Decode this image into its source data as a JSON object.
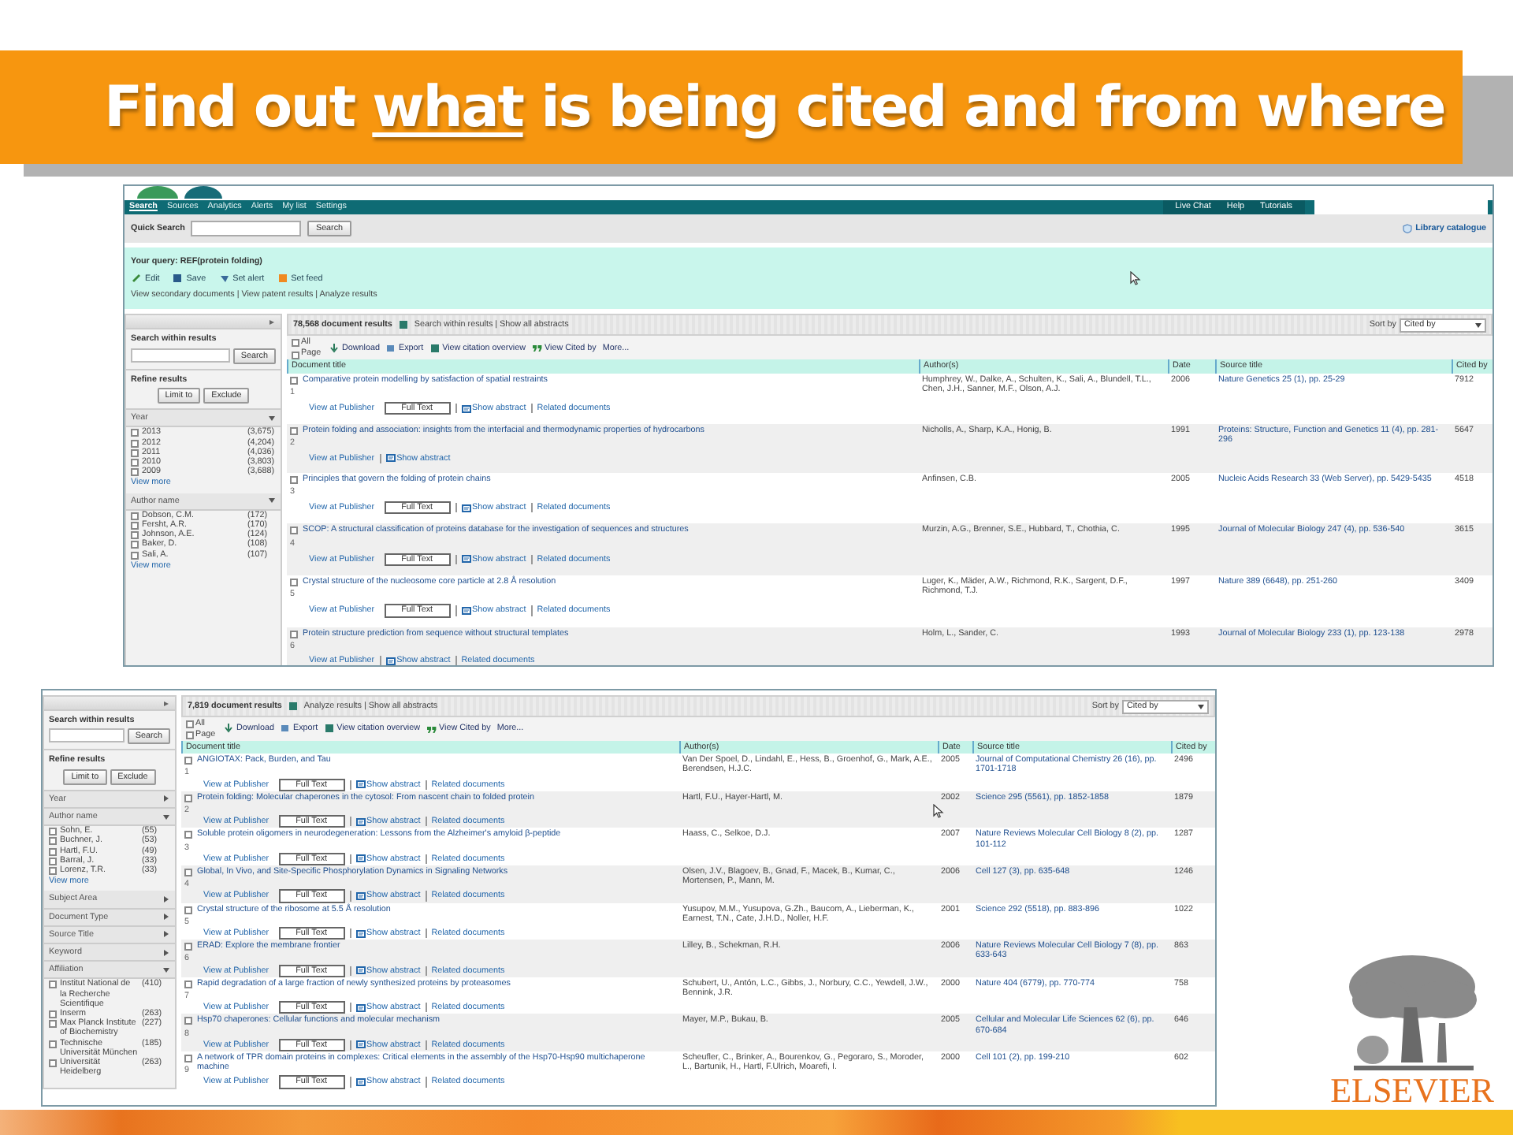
{
  "slide": {
    "title_parts": [
      {
        "text": "Find out ",
        "underlined": false
      },
      {
        "text": "what",
        "underlined": true
      },
      {
        "text": " is being cited and from where",
        "underlined": false
      }
    ]
  },
  "screenshots": [
    {
      "nav": {
        "tabs": [
          {
            "label": "Search",
            "selected": true
          },
          {
            "label": "Sources",
            "selected": false
          },
          {
            "label": "Analytics",
            "selected": false
          },
          {
            "label": "Alerts",
            "selected": false
          },
          {
            "label": "My list",
            "selected": false
          },
          {
            "label": "Settings",
            "selected": false
          }
        ],
        "links": [
          "Live Chat",
          "Help",
          "Tutorials"
        ]
      },
      "quick_search": {
        "label": "Quick Search",
        "button": "Search",
        "catalogue": "Library catalogue"
      },
      "query": {
        "text": "Your query: REF(protein folding)",
        "actions": [
          "Edit",
          "Save",
          "Set alert",
          "Set feed"
        ],
        "related": "View secondary documents | View patent results | Analyze results"
      },
      "sidebar": {
        "search_label": "Search within results",
        "search_button": "Search",
        "refine_label": "Refine results",
        "limit_button": "Limit to",
        "exclude_button": "Exclude",
        "facets": [
          {
            "title": "Year",
            "expanded": true,
            "items": [
              {
                "label": "2013",
                "count": "(3,675)",
                "checked": false
              },
              {
                "label": "2012",
                "count": "(4,204)",
                "checked": false
              },
              {
                "label": "2011",
                "count": "(4,036)",
                "checked": false
              },
              {
                "label": "2010",
                "count": "(3,803)",
                "checked": false
              },
              {
                "label": "2009",
                "count": "(3,688)",
                "checked": false
              }
            ],
            "more": "View more"
          },
          {
            "title": "Author name",
            "expanded": true,
            "items": [
              {
                "label": "Dobson, C.M.",
                "count": "(172)",
                "checked": false
              },
              {
                "label": "Fersht, A.R.",
                "count": "(170)",
                "checked": false
              },
              {
                "label": "Johnson, A.E.",
                "count": "(124)",
                "checked": false
              },
              {
                "label": "Baker, D.",
                "count": "(108)",
                "checked": false
              },
              {
                "label": "Sali, A.",
                "count": "(107)",
                "checked": false
              }
            ],
            "more": "View more"
          }
        ]
      },
      "results": {
        "count": "78,568 document results",
        "count_links": "Search within results | Show all abstracts",
        "sort_label": "Sort by",
        "sort_value": "Cited by",
        "select": [
          {
            "label": "All",
            "checked": false
          },
          {
            "label": "Page",
            "checked": false
          }
        ],
        "tools": [
          "Download",
          "Export",
          "View citation overview",
          "View Cited by",
          "More..."
        ],
        "columns": [
          "Document title",
          "Author(s)",
          "Date",
          "Source title",
          "Cited by"
        ],
        "rows": [
          {
            "number": "1",
            "title": "Comparative protein modelling by satisfaction of spatial restraints",
            "authors": "Humphrey, W., Dalke, A., Schulten, K., Sali, A., Blundell, T.L., Chen, J.H., Sanner, M.F., Olson, A.J.",
            "date": "2006",
            "source": "Nature Genetics 25 (1), pp. 25-29",
            "cited": "7912",
            "checked": false,
            "full_text": true,
            "links": [
              "View at Publisher",
              "Full Text",
              "Show abstract",
              "Related documents"
            ]
          },
          {
            "number": "2",
            "title": "Protein folding and association: insights from the interfacial and thermodynamic properties of hydrocarbons",
            "authors": "Nicholls, A., Sharp, K.A., Honig, B.",
            "date": "1991",
            "source": "Proteins: Structure, Function and Genetics 11 (4), pp. 281-296",
            "cited": "5647",
            "checked": false,
            "full_text": false,
            "links": [
              "View at Publisher",
              "Show abstract"
            ]
          },
          {
            "number": "3",
            "title": "Principles that govern the folding of protein chains",
            "authors": "Anfinsen, C.B.",
            "date": "2005",
            "source": "Nucleic Acids Research 33 (Web Server), pp. 5429-5435",
            "cited": "4518",
            "checked": false,
            "full_text": true,
            "links": [
              "View at Publisher",
              "Full Text",
              "Show abstract",
              "Related documents"
            ]
          },
          {
            "number": "4",
            "title": "SCOP: A structural classification of proteins database for the investigation of sequences and structures",
            "authors": "Murzin, A.G., Brenner, S.E., Hubbard, T., Chothia, C.",
            "date": "1995",
            "source": "Journal of Molecular Biology 247 (4), pp. 536-540",
            "cited": "3615",
            "checked": false,
            "full_text": true,
            "links": [
              "View at Publisher",
              "Full Text",
              "Show abstract",
              "Related documents"
            ]
          },
          {
            "number": "5",
            "title": "Crystal structure of the nucleosome core particle at 2.8 Å resolution",
            "authors": "Luger, K., Mäder, A.W., Richmond, R.K., Sargent, D.F., Richmond, T.J.",
            "date": "1997",
            "source": "Nature 389 (6648), pp. 251-260",
            "cited": "3409",
            "checked": false,
            "full_text": true,
            "links": [
              "View at Publisher",
              "Full Text",
              "Show abstract",
              "Related documents"
            ]
          },
          {
            "number": "6",
            "title": "Protein structure prediction from sequence without structural templates",
            "authors": "Holm, L., Sander, C.",
            "date": "1993",
            "source": "Journal of Molecular Biology 233 (1), pp. 123-138",
            "cited": "2978",
            "checked": false,
            "full_text": false,
            "links": [
              "View at Publisher",
              "Show abstract",
              "Related documents"
            ]
          }
        ]
      }
    },
    {
      "sidebar": {
        "search_label": "Search within results",
        "search_button": "Search",
        "refine_label": "Refine results",
        "limit_button": "Limit to",
        "exclude_button": "Exclude",
        "facets": [
          {
            "title": "Year",
            "expanded": false
          },
          {
            "title": "Author name",
            "expanded": true,
            "items": [
              {
                "label": "Sohn, E.",
                "count": "(55)",
                "checked": false
              },
              {
                "label": "Buchner, J.",
                "count": "(53)",
                "checked": false
              },
              {
                "label": "Hartl, F.U.",
                "count": "(49)",
                "checked": false
              },
              {
                "label": "Barral, J.",
                "count": "(33)",
                "checked": false
              },
              {
                "label": "Lorenz, T.R.",
                "count": "(33)",
                "checked": false
              }
            ],
            "more": "View more"
          },
          {
            "title": "Subject Area",
            "expanded": false
          },
          {
            "title": "Document Type",
            "expanded": false
          },
          {
            "title": "Source Title",
            "expanded": false
          },
          {
            "title": "Keyword",
            "expanded": false
          },
          {
            "title": "Affiliation",
            "expanded": true,
            "items": [
              {
                "label": "Institut National de la Recherche Scientifique",
                "count": "(410)",
                "checked": false
              },
              {
                "label": "Inserm",
                "count": "(263)",
                "checked": false
              },
              {
                "label": "Max Planck Institute of Biochemistry",
                "count": "(227)",
                "checked": false
              },
              {
                "label": "Technische Universität München",
                "count": "(185)",
                "checked": false
              },
              {
                "label": "Universität Heidelberg",
                "count": "(263)",
                "checked": false
              }
            ]
          }
        ]
      },
      "results": {
        "count": "7,819 document results",
        "count_links": "Analyze results | Show all abstracts",
        "sort_label": "Sort by",
        "sort_value": "Cited by",
        "select": [
          {
            "label": "All",
            "checked": false
          },
          {
            "label": "Page",
            "checked": false
          }
        ],
        "tools": [
          "Download",
          "Export",
          "View citation overview",
          "View Cited by",
          "More..."
        ],
        "columns": [
          "Document title",
          "Author(s)",
          "Date",
          "Source title",
          "Cited by"
        ],
        "rows": [
          {
            "number": "1",
            "title": "ANGIOTAX: Pack, Burden, and Tau",
            "authors": "Van Der Spoel, D., Lindahl, E., Hess, B., Groenhof, G., Mark, A.E., Berendsen, H.J.C.",
            "date": "2005",
            "source": "Journal of Computational Chemistry 26 (16), pp. 1701-1718",
            "cited": "2496",
            "checked": false,
            "full_text": true,
            "links": [
              "View at Publisher",
              "Full Text",
              "Show abstract",
              "Related documents"
            ]
          },
          {
            "number": "2",
            "title": "Protein folding: Molecular chaperones in the cytosol: From nascent chain to folded protein",
            "authors": "Hartl, F.U., Hayer-Hartl, M.",
            "date": "2002",
            "source": "Science 295 (5561), pp. 1852-1858",
            "cited": "1879",
            "checked": false,
            "full_text": true,
            "links": [
              "View at Publisher",
              "Full Text",
              "Show abstract",
              "Related documents"
            ]
          },
          {
            "number": "3",
            "title": "Soluble protein oligomers in neurodegeneration: Lessons from the Alzheimer's amyloid β-peptide",
            "authors": "Haass, C., Selkoe, D.J.",
            "date": "2007",
            "source": "Nature Reviews Molecular Cell Biology 8 (2), pp. 101-112",
            "cited": "1287",
            "checked": false,
            "full_text": true,
            "links": [
              "View at Publisher",
              "Full Text",
              "Show abstract",
              "Related documents"
            ]
          },
          {
            "number": "4",
            "title": "Global, In Vivo, and Site-Specific Phosphorylation Dynamics in Signaling Networks",
            "authors": "Olsen, J.V., Blagoev, B., Gnad, F., Macek, B., Kumar, C., Mortensen, P., Mann, M.",
            "date": "2006",
            "source": "Cell 127 (3), pp. 635-648",
            "cited": "1246",
            "checked": false,
            "full_text": true,
            "links": [
              "View at Publisher",
              "Full Text",
              "Show abstract",
              "Related documents"
            ]
          },
          {
            "number": "5",
            "title": "Crystal structure of the ribosome at 5.5 Å resolution",
            "authors": "Yusupov, M.M., Yusupova, G.Zh., Baucom, A., Lieberman, K., Earnest, T.N., Cate, J.H.D., Noller, H.F.",
            "date": "2001",
            "source": "Science 292 (5518), pp. 883-896",
            "cited": "1022",
            "checked": false,
            "full_text": true,
            "links": [
              "View at Publisher",
              "Full Text",
              "Show abstract",
              "Related documents"
            ]
          },
          {
            "number": "6",
            "title": "ERAD: Explore the membrane frontier",
            "authors": "Lilley, B., Schekman, R.H.",
            "date": "2006",
            "source": "Nature Reviews Molecular Cell Biology 7 (8), pp. 633-643",
            "cited": "863",
            "checked": false,
            "full_text": true,
            "links": [
              "View at Publisher",
              "Full Text",
              "Show abstract",
              "Related documents"
            ]
          },
          {
            "number": "7",
            "title": "Rapid degradation of a large fraction of newly synthesized proteins by proteasomes",
            "authors": "Schubert, U., Antón, L.C., Gibbs, J., Norbury, C.C., Yewdell, J.W., Bennink, J.R.",
            "date": "2000",
            "source": "Nature 404 (6779), pp. 770-774",
            "cited": "758",
            "checked": false,
            "full_text": true,
            "links": [
              "View at Publisher",
              "Full Text",
              "Show abstract",
              "Related documents"
            ]
          },
          {
            "number": "8",
            "title": "Hsp70 chaperones: Cellular functions and molecular mechanism",
            "authors": "Mayer, M.P., Bukau, B.",
            "date": "2005",
            "source": "Cellular and Molecular Life Sciences 62 (6), pp. 670-684",
            "cited": "646",
            "checked": false,
            "full_text": true,
            "links": [
              "View at Publisher",
              "Full Text",
              "Show abstract",
              "Related documents"
            ]
          },
          {
            "number": "9",
            "title": "A network of TPR domain proteins in complexes: Critical elements in the assembly of the Hsp70-Hsp90 multichaperone machine",
            "authors": "Scheufler, C., Brinker, A., Bourenkov, G., Pegoraro, S., Moroder, L., Bartunik, H., Hartl, F.Ulrich, Moarefi, I.",
            "date": "2000",
            "source": "Cell 101 (2), pp. 199-210",
            "cited": "602",
            "checked": false,
            "full_text": true,
            "links": [
              "View at Publisher",
              "Full Text",
              "Show abstract",
              "Related documents"
            ]
          }
        ]
      }
    }
  ],
  "logo": {
    "wordmark": "ELSEVIER"
  }
}
